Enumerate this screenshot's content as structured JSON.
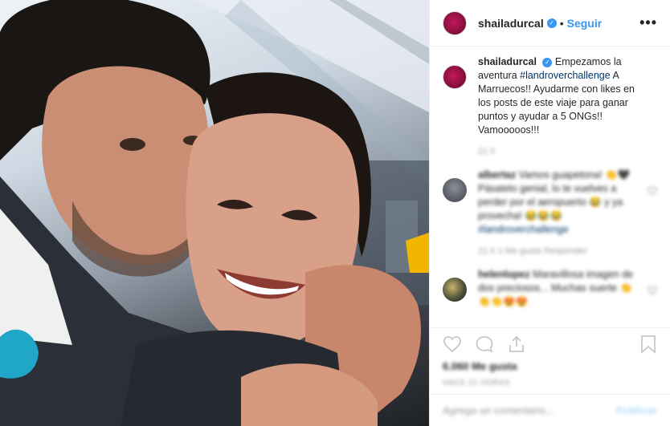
{
  "post": {
    "username": "shailadurcal",
    "follow_label": "Seguir",
    "separator": "•",
    "more_label": "•••",
    "caption_username": "shailadurcal",
    "caption_text_1": "Empezamos la aventura ",
    "caption_hashtag": "#landroverchallenge",
    "caption_text_2": " A Marruecos!! Ayudarme con likes en los posts de este viaje para ganar puntos y ayudar a 5 ONGs!! Vamooooos!!!",
    "caption_time": "21 h"
  },
  "comments": [
    {
      "username": "albertaz",
      "text": "Vamos guapetona! 👏🖤 Pásatelo genial, lo te vuelves a perder por el aeropuerto 😂 y ya provecha! 😂😂😂",
      "hashtag": "#landroverchallenge",
      "meta": "21 h   1 Me gusta   Responder"
    },
    {
      "username": "helenlopez",
      "text": "Maravillosa imagen de dos preciosos... Muchas suerte 👏👏👏😍😍",
      "meta": ""
    }
  ],
  "footer": {
    "likes": "6.060 Me gusta",
    "date": "HACE 21 HORAS",
    "comment_placeholder": "Agrega un comentario...",
    "publish_label": "Publicar"
  },
  "colors": {
    "accent": "#3897f0",
    "hashtag": "#003569",
    "avatar": "#8e1040",
    "publish_disabled": "#b2dffc"
  }
}
